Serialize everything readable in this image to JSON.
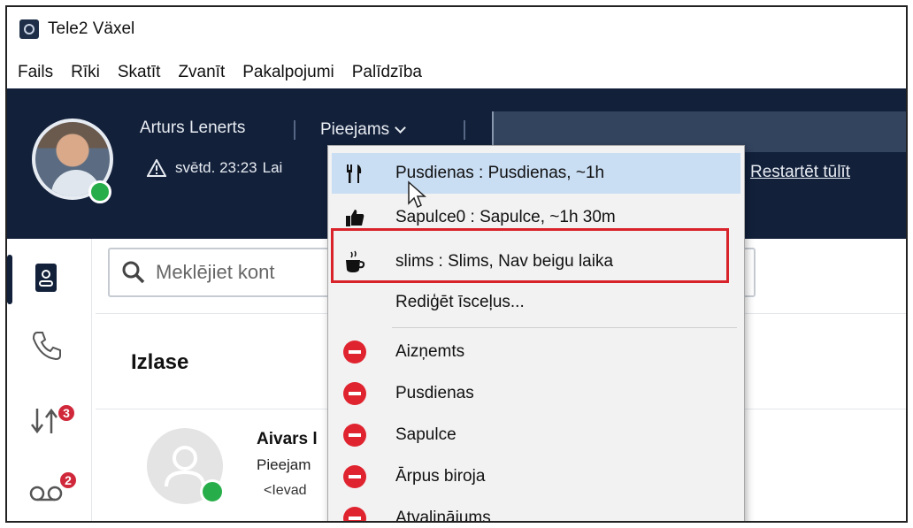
{
  "window": {
    "title": "Tele2 Växel"
  },
  "menubar": {
    "items": [
      "Fails",
      "Rīki",
      "Skatīt",
      "Zvanīt",
      "Pakalpojumi",
      "Palīdzība"
    ]
  },
  "header": {
    "user_name": "Arturs Lenerts",
    "status": "Pieejams",
    "warning_text": "svētd. 23:23",
    "warning_trailing": "Lai",
    "restart_link": "Restartēt tūlīt"
  },
  "rail": {
    "history_badge": "3",
    "voicemail_badge": "2"
  },
  "search": {
    "placeholder": "Meklējiet kont"
  },
  "favorites": {
    "title": "Izlase",
    "contact": {
      "name": "Aivars l",
      "status": "Pieejam",
      "extension": "<Ievad"
    }
  },
  "dropdown": {
    "shortcuts": [
      {
        "label": "Pusdienas : Pusdienas, ~1h",
        "icon": "fork-knife-icon"
      },
      {
        "label": "Sapulce0 : Sapulce, ~1h 30m",
        "icon": "thumbs-up-icon"
      },
      {
        "label": "slims : Slims, Nav beigu laika",
        "icon": "coffee-cup-icon"
      }
    ],
    "edit_label": "Rediģēt īsceļus...",
    "statuses": [
      "Aizņemts",
      "Pusdienas",
      "Sapulce",
      "Ārpus biroja",
      "Atvaļinājums"
    ]
  },
  "colors": {
    "header_bg": "#12203a",
    "highlight": "#c9ddf3",
    "busy_red": "#e0242f",
    "online_green": "#27ae4a",
    "annotation_red": "#d8232a"
  }
}
